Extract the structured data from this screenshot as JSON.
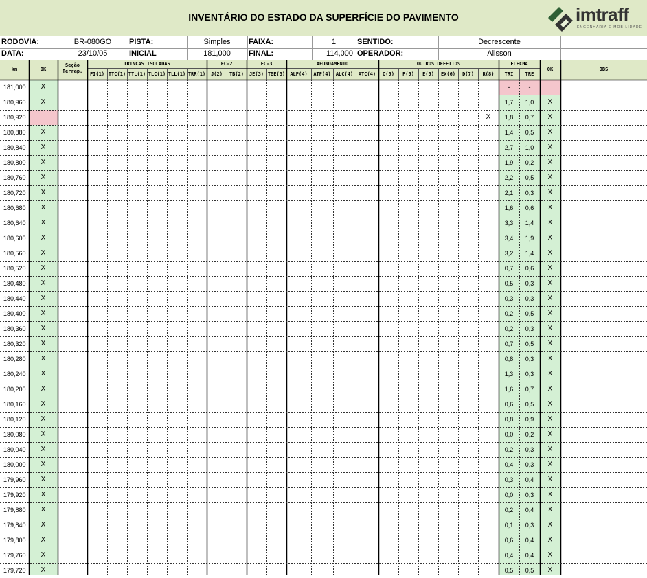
{
  "title": "INVENTÁRIO DO ESTADO DA SUPERFÍCIE DO PAVIMENTO",
  "logo": {
    "name": "imtraff",
    "tagline": "ENGENHARIA E MOBILIDADE"
  },
  "info": {
    "rodovia_label": "RODOVIA:",
    "rodovia": "BR-080GO",
    "pista_label": "PISTA:",
    "pista": "Simples",
    "faixa_label": "FAIXA:",
    "faixa": "1",
    "sentido_label": "SENTIDO:",
    "sentido": "Decrescente",
    "data_label": "DATA:",
    "data": "23/10/05",
    "inicial_label": "INICIAL",
    "inicial": "181,000",
    "final_label": "FINAL:",
    "final": "114,000",
    "operador_label": "OPERADOR:",
    "operador": "Alisson"
  },
  "headers": {
    "km": "km",
    "ok": "OK",
    "secao_1": "Seção",
    "secao_2": "Terrap.",
    "trincas": "TRINCAS ISOLADAS",
    "fc2": "FC-2",
    "fc3": "FC-3",
    "afundamento": "AFUNDAMENTO",
    "outros": "OUTROS DEFEITOS",
    "flecha": "FLECHA",
    "ok2": "OK",
    "obs": "OBS",
    "sub": [
      "FI(1)",
      "TTC(1)",
      "TTL(1)",
      "TLC(1)",
      "TLL(1)",
      "TRR(1)",
      "J(2)",
      "TB(2)",
      "JE(3)",
      "TBE(3)",
      "ALP(4)",
      "ATP(4)",
      "ALC(4)",
      "ATC(4)",
      "O(5)",
      "P(5)",
      "E(5)",
      "EX(6)",
      "D(7)",
      "R(8)",
      "TRI",
      "TRE"
    ]
  },
  "rows": [
    {
      "km": "181,000",
      "ok": "X",
      "r8": "",
      "tri": "-",
      "tre": "-",
      "ok2": ""
    },
    {
      "km": "180,960",
      "ok": "X",
      "r8": "",
      "tri": "1,7",
      "tre": "1,0",
      "ok2": "X"
    },
    {
      "km": "180,920",
      "ok": "",
      "r8": "X",
      "tri": "1,8",
      "tre": "0,7",
      "ok2": "X"
    },
    {
      "km": "180,880",
      "ok": "X",
      "r8": "",
      "tri": "1,4",
      "tre": "0,5",
      "ok2": "X"
    },
    {
      "km": "180,840",
      "ok": "X",
      "r8": "",
      "tri": "2,7",
      "tre": "1,0",
      "ok2": "X"
    },
    {
      "km": "180,800",
      "ok": "X",
      "r8": "",
      "tri": "1,9",
      "tre": "0,2",
      "ok2": "X"
    },
    {
      "km": "180,760",
      "ok": "X",
      "r8": "",
      "tri": "2,2",
      "tre": "0,5",
      "ok2": "X"
    },
    {
      "km": "180,720",
      "ok": "X",
      "r8": "",
      "tri": "2,1",
      "tre": "0,3",
      "ok2": "X"
    },
    {
      "km": "180,680",
      "ok": "X",
      "r8": "",
      "tri": "1,6",
      "tre": "0,6",
      "ok2": "X"
    },
    {
      "km": "180,640",
      "ok": "X",
      "r8": "",
      "tri": "3,3",
      "tre": "1,4",
      "ok2": "X"
    },
    {
      "km": "180,600",
      "ok": "X",
      "r8": "",
      "tri": "3,4",
      "tre": "1,9",
      "ok2": "X"
    },
    {
      "km": "180,560",
      "ok": "X",
      "r8": "",
      "tri": "3,2",
      "tre": "1,4",
      "ok2": "X"
    },
    {
      "km": "180,520",
      "ok": "X",
      "r8": "",
      "tri": "0,7",
      "tre": "0,6",
      "ok2": "X"
    },
    {
      "km": "180,480",
      "ok": "X",
      "r8": "",
      "tri": "0,5",
      "tre": "0,3",
      "ok2": "X"
    },
    {
      "km": "180,440",
      "ok": "X",
      "r8": "",
      "tri": "0,3",
      "tre": "0,3",
      "ok2": "X"
    },
    {
      "km": "180,400",
      "ok": "X",
      "r8": "",
      "tri": "0,2",
      "tre": "0,5",
      "ok2": "X"
    },
    {
      "km": "180,360",
      "ok": "X",
      "r8": "",
      "tri": "0,2",
      "tre": "0,3",
      "ok2": "X"
    },
    {
      "km": "180,320",
      "ok": "X",
      "r8": "",
      "tri": "0,7",
      "tre": "0,5",
      "ok2": "X"
    },
    {
      "km": "180,280",
      "ok": "X",
      "r8": "",
      "tri": "0,8",
      "tre": "0,3",
      "ok2": "X"
    },
    {
      "km": "180,240",
      "ok": "X",
      "r8": "",
      "tri": "1,3",
      "tre": "0,3",
      "ok2": "X"
    },
    {
      "km": "180,200",
      "ok": "X",
      "r8": "",
      "tri": "1,6",
      "tre": "0,7",
      "ok2": "X"
    },
    {
      "km": "180,160",
      "ok": "X",
      "r8": "",
      "tri": "0,6",
      "tre": "0,5",
      "ok2": "X"
    },
    {
      "km": "180,120",
      "ok": "X",
      "r8": "",
      "tri": "0,8",
      "tre": "0,9",
      "ok2": "X"
    },
    {
      "km": "180,080",
      "ok": "X",
      "r8": "",
      "tri": "0,0",
      "tre": "0,2",
      "ok2": "X"
    },
    {
      "km": "180,040",
      "ok": "X",
      "r8": "",
      "tri": "0,2",
      "tre": "0,3",
      "ok2": "X"
    },
    {
      "km": "180,000",
      "ok": "X",
      "r8": "",
      "tri": "0,4",
      "tre": "0,3",
      "ok2": "X"
    },
    {
      "km": "179,960",
      "ok": "X",
      "r8": "",
      "tri": "0,3",
      "tre": "0,4",
      "ok2": "X"
    },
    {
      "km": "179,920",
      "ok": "X",
      "r8": "",
      "tri": "0,0",
      "tre": "0,3",
      "ok2": "X"
    },
    {
      "km": "179,880",
      "ok": "X",
      "r8": "",
      "tri": "0,2",
      "tre": "0,4",
      "ok2": "X"
    },
    {
      "km": "179,840",
      "ok": "X",
      "r8": "",
      "tri": "0,1",
      "tre": "0,3",
      "ok2": "X"
    },
    {
      "km": "179,800",
      "ok": "X",
      "r8": "",
      "tri": "0,6",
      "tre": "0,4",
      "ok2": "X"
    },
    {
      "km": "179,760",
      "ok": "X",
      "r8": "",
      "tri": "0,4",
      "tre": "0,4",
      "ok2": "X"
    },
    {
      "km": "179,720",
      "ok": "X",
      "r8": "",
      "tri": "0,5",
      "tre": "0,5",
      "ok2": "X"
    }
  ],
  "colors": {
    "header_green": "#dfe9c7",
    "ok_green": "#d4f0d4",
    "alert_pink": "#f4c6cc"
  }
}
